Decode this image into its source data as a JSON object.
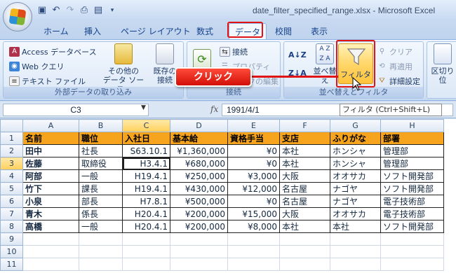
{
  "window": {
    "title": "date_filter_specified_range.xlsx - Microsoft Excel"
  },
  "tabs": [
    "ホーム",
    "挿入",
    "ページ レイアウト",
    "数式",
    "データ",
    "校閲",
    "表示"
  ],
  "active_tab": "データ",
  "ribbon": {
    "external": {
      "access": "Access データベース",
      "web": "Web クエリ",
      "text": "テキスト ファイル",
      "other_line1": "その他の",
      "other_line2": "データ ソース",
      "existing_line1": "既存の",
      "existing_line2": "接続",
      "label": "外部データの取り込み"
    },
    "connections": {
      "connect": "接続",
      "properties": "プロパティ",
      "edit_links": "リンクの編集",
      "label": "接続"
    },
    "sort_filter": {
      "sort": "並べ替え",
      "filter": "フィルタ",
      "clear": "クリア",
      "reapply": "再適用",
      "advanced": "詳細設定",
      "label": "並べ替えとフィルタ"
    },
    "data_tools": {
      "text_to_columns": "区切り位"
    }
  },
  "callout": "クリック",
  "tooltip": "フィルタ (Ctrl+Shift+L)",
  "formula_bar": {
    "name_box": "C3",
    "fx": "fx",
    "value": "1991/4/1"
  },
  "sheet": {
    "columns": [
      "A",
      "B",
      "C",
      "D",
      "E",
      "F",
      "G",
      "H"
    ],
    "selected_column": "C",
    "selected_row": 3,
    "headers": [
      "名前",
      "職位",
      "入社日",
      "基本給",
      "資格手当",
      "支店",
      "ふりがな",
      "部署"
    ],
    "rows": [
      [
        "田中",
        "社長",
        "S63.10.1",
        "¥1,360,000",
        "¥0",
        "本社",
        "ホンシャ",
        "管理部"
      ],
      [
        "佐藤",
        "取締役",
        "H3.4.1",
        "¥680,000",
        "¥0",
        "本社",
        "ホンシャ",
        "管理部"
      ],
      [
        "阿部",
        "一般",
        "H19.4.1",
        "¥250,000",
        "¥3,000",
        "大阪",
        "オオサカ",
        "ソフト開発部"
      ],
      [
        "竹下",
        "課長",
        "H19.4.1",
        "¥430,000",
        "¥12,000",
        "名古屋",
        "ナゴヤ",
        "ソフト開発部"
      ],
      [
        "小泉",
        "部長",
        "H7.8.1",
        "¥500,000",
        "¥0",
        "名古屋",
        "ナゴヤ",
        "電子技術部"
      ],
      [
        "青木",
        "係長",
        "H20.4.1",
        "¥200,000",
        "¥15,000",
        "大阪",
        "オオサカ",
        "電子技術部"
      ],
      [
        "高橋",
        "一般",
        "H20.4.1",
        "¥200,000",
        "¥8,000",
        "本社",
        "本社",
        "ソフト開発部"
      ]
    ],
    "row_numbers": [
      "1",
      "2",
      "3",
      "4",
      "5",
      "6",
      "7",
      "8",
      "9",
      "10",
      "11"
    ],
    "colors": {
      "header_fill": "#f6a31d",
      "highlight_red": "#e01414"
    }
  }
}
